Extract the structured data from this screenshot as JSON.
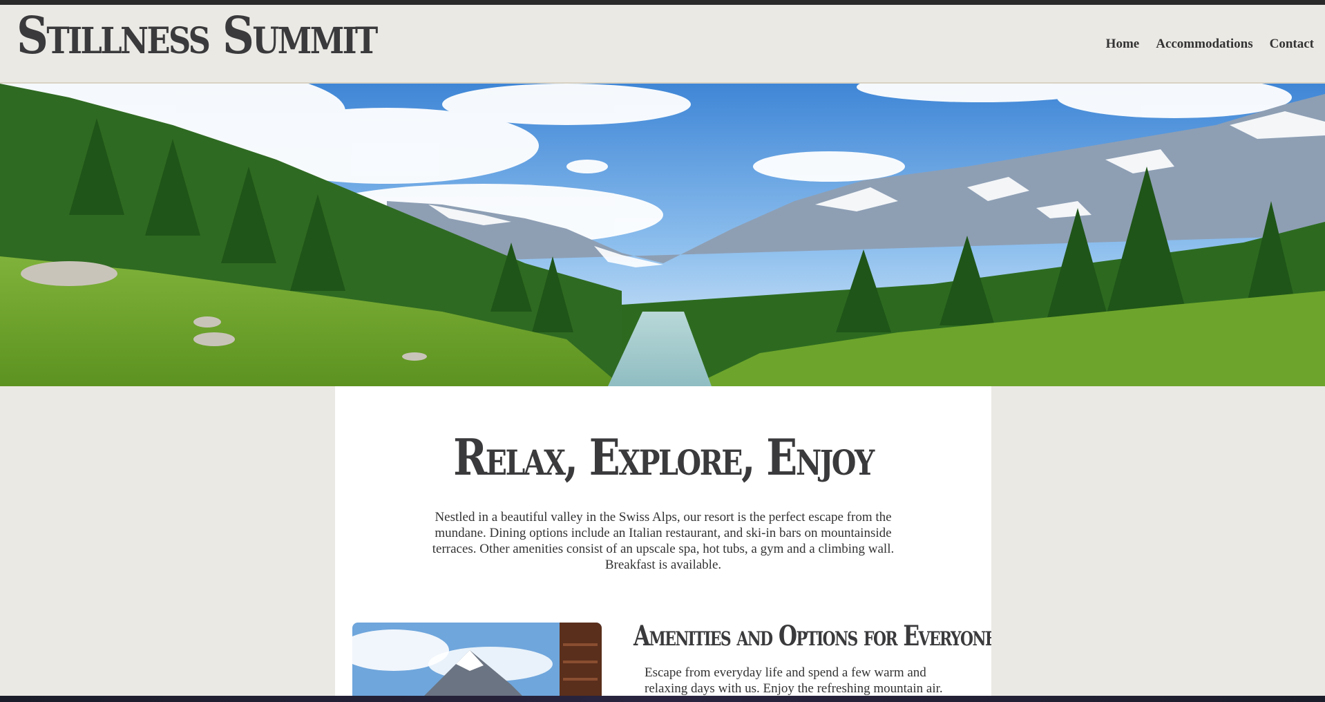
{
  "header": {
    "logo": "Stillness Summit",
    "nav": [
      "Home",
      "Accommodations",
      "Contact"
    ]
  },
  "hero": {
    "image": "alpine valley with pine forest, snowy mountains and river"
  },
  "main": {
    "headline": "Relax, Explore, Enjoy",
    "intro": "Nestled in a beautiful valley in the Swiss Alps, our resort is the perfect escape from the mundane. Dining options include an Italian restaurant, and ski-in bars on mountainside terraces. Other amenities consist of an upscale spa, hot tubs, a gym and a climbing wall. Breakfast is available.",
    "amenities": {
      "title": "Amenities and Options for Everyone",
      "text": "Escape from everyday life and spend a few warm and relaxing days with us. Enjoy the refreshing mountain air."
    }
  },
  "colors": {
    "page_bg": "#ebe9e4",
    "text": "#333333",
    "heading": "#3a3a3c"
  }
}
